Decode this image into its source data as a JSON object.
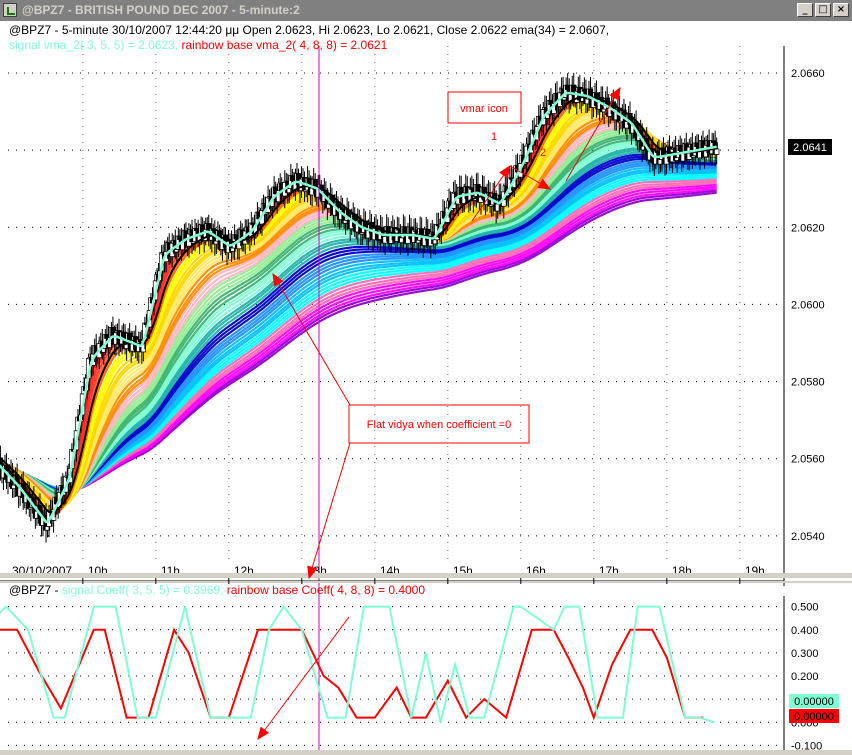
{
  "window": {
    "title": "@BPZ7 - BRITISH POUND DEC 2007 - 5-minute:2",
    "buttons": {
      "minimize": "_",
      "maximize": "□",
      "close": "×"
    }
  },
  "price_panel": {
    "info_line1": "@BPZ7 - 5-minute 30/10/2007 12:44:20 μμ Open 2.0623, Hi 2.0623, Lo 2.0621, Close 2.0622 ema(34) = 2.0607,",
    "info_line2_signal": "signal vma_2( 3, 5, 5) = 2.0623,",
    "info_line2_rainbow": "rainbow base vma_2( 4, 8, 8) = 2.0621",
    "last_price": "2.0641",
    "annotations": {
      "vmar": "vmar icon",
      "flat": "Flat vidya when coefficient =0",
      "label1": "1",
      "label2": "2"
    }
  },
  "coeff_panel": {
    "info_prefix": "@BPZ7 -",
    "info_signal": "signal Coeff( 3, 5, 5) = 0.3969,",
    "info_rainbow": "rainbow base Coeff( 4, 8, 8) = 0.4000",
    "last_signal": "0.00000",
    "last_rainbow": "0.00000"
  },
  "colors": {
    "signal_line": "#7fffd4",
    "rainbow_line": "#ff0000",
    "annotation": "#ff0000",
    "time_marker": "#cc00cc",
    "ema": "#000000"
  },
  "chart_data": [
    {
      "type": "candlestick",
      "title": "@BPZ7 - BRITISH POUND DEC 2007 - 5-minute:2",
      "x_tick_labels": [
        "30/10/2007",
        "10h",
        "11h",
        "12h",
        "13h",
        "14h",
        "15h",
        "16h",
        "17h",
        "18h",
        "19h"
      ],
      "y_tick_labels": [
        "2.0540",
        "2.0560",
        "2.0580",
        "2.0600",
        "2.0620",
        "2.0640",
        "2.0660"
      ],
      "ylim": [
        2.0534,
        2.0667
      ],
      "grid": "dotted",
      "close_path": {
        "x_hour": [
          8.6,
          9.1,
          9.5,
          9.8,
          10.1,
          10.4,
          10.8,
          11.1,
          11.4,
          11.7,
          12.0,
          12.3,
          12.6,
          12.9,
          13.2,
          13.5,
          13.8,
          14.1,
          14.5,
          14.8,
          15.1,
          15.4,
          15.7,
          16.0,
          16.3,
          16.6,
          16.9,
          17.2,
          17.5,
          17.8,
          18.1,
          18.4,
          18.7
        ],
        "price": [
          2.0563,
          2.0553,
          2.0543,
          2.0555,
          2.0586,
          2.0592,
          2.0589,
          2.0613,
          2.0617,
          2.0619,
          2.0615,
          2.0619,
          2.0628,
          2.0632,
          2.063,
          2.0624,
          2.062,
          2.0618,
          2.0618,
          2.0617,
          2.0628,
          2.0629,
          2.0626,
          2.0636,
          2.0649,
          2.0655,
          2.0654,
          2.0651,
          2.0647,
          2.0638,
          2.0639,
          2.064,
          2.0641
        ]
      },
      "open": 2.0623,
      "high": 2.0623,
      "low": 2.0621,
      "close": 2.0622,
      "ema34": 2.0607,
      "signal_vma": 2.0623,
      "rainbow_base_vma": 2.0621,
      "last": 2.0641
    },
    {
      "type": "line",
      "x_tick_labels": [],
      "y_tick_labels": [
        "-0.100",
        "0.000",
        "0.100",
        "0.200",
        "0.300",
        "0.400",
        "0.500"
      ],
      "ylim": [
        -0.12,
        0.52
      ],
      "series": [
        {
          "name": "signal Coeff( 3, 5, 5)",
          "color": "#7fffd4",
          "x_hour": [
            8.6,
            8.95,
            9.25,
            9.6,
            9.75,
            10.15,
            10.45,
            10.75,
            11.0,
            11.4,
            11.75,
            12.3,
            12.55,
            12.75,
            13.0,
            13.35,
            13.6,
            13.85,
            14.2,
            14.5,
            14.7,
            14.9,
            15.1,
            15.3,
            15.5,
            15.9,
            16.0,
            16.45,
            16.6,
            16.8,
            17.05,
            17.4,
            17.6,
            17.9,
            18.25,
            18.45,
            18.65
          ],
          "values": [
            0.4,
            0.5,
            0.4,
            0.02,
            0.02,
            0.5,
            0.5,
            0.02,
            0.02,
            0.5,
            0.02,
            0.02,
            0.4,
            0.5,
            0.4,
            0.02,
            0.02,
            0.5,
            0.5,
            0.02,
            0.3,
            0.0,
            0.25,
            0.02,
            0.02,
            0.5,
            0.5,
            0.4,
            0.5,
            0.5,
            0.02,
            0.02,
            0.5,
            0.5,
            0.02,
            0.02,
            0.0
          ]
        },
        {
          "name": "rainbow base Coeff( 4, 8, 8)",
          "color": "#ff0000",
          "x_hour": [
            8.6,
            9.1,
            9.4,
            9.7,
            10.15,
            10.3,
            10.6,
            10.9,
            11.25,
            11.45,
            11.75,
            12.0,
            12.4,
            12.7,
            13.0,
            13.3,
            13.5,
            13.75,
            14.0,
            14.3,
            14.5,
            14.7,
            15.0,
            15.25,
            15.5,
            15.8,
            16.15,
            16.45,
            16.65,
            16.85,
            17.0,
            17.25,
            17.5,
            17.8,
            18.0,
            18.25,
            18.5
          ],
          "values": [
            0.4,
            0.4,
            0.22,
            0.06,
            0.4,
            0.4,
            0.02,
            0.02,
            0.4,
            0.3,
            0.02,
            0.02,
            0.4,
            0.4,
            0.4,
            0.2,
            0.15,
            0.02,
            0.02,
            0.15,
            0.02,
            0.02,
            0.18,
            0.02,
            0.1,
            0.02,
            0.4,
            0.4,
            0.28,
            0.15,
            0.02,
            0.25,
            0.4,
            0.4,
            0.28,
            0.02,
            0.02
          ]
        }
      ]
    }
  ]
}
